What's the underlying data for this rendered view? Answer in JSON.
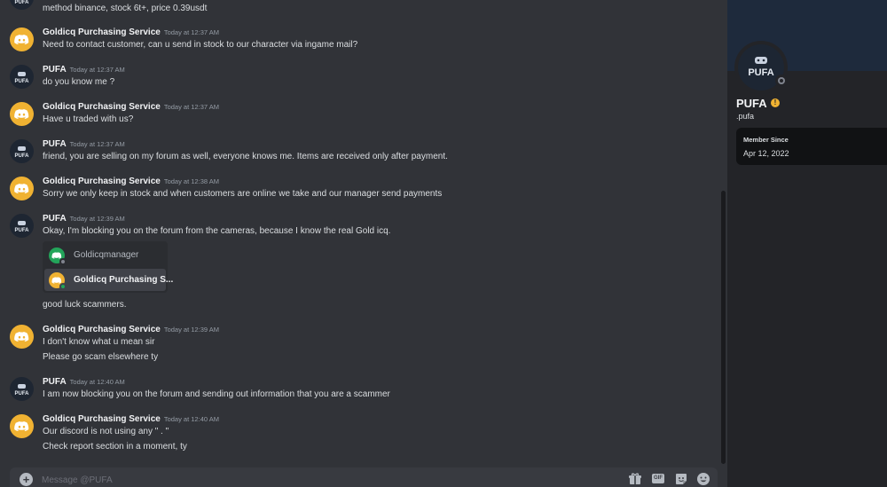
{
  "chat": {
    "messages": [
      {
        "id": "m0",
        "author": "",
        "time": "",
        "avatar": "pufa",
        "lines": [
          "method binance, stock 6t+, price 0.39usdt"
        ]
      },
      {
        "id": "m1",
        "author": "Goldicq Purchasing Service",
        "time": "Today at 12:37 AM",
        "avatar": "discord-yellow",
        "lines": [
          "Need to contact customer, can u send in stock to our character via ingame mail?"
        ]
      },
      {
        "id": "m2",
        "author": "PUFA",
        "time": "Today at 12:37 AM",
        "avatar": "pufa",
        "lines": [
          "do you know me  ?"
        ]
      },
      {
        "id": "m3",
        "author": "Goldicq Purchasing Service",
        "time": "Today at 12:37 AM",
        "avatar": "discord-yellow",
        "lines": [
          "Have u traded with us?"
        ]
      },
      {
        "id": "m4",
        "author": "PUFA",
        "time": "Today at 12:37 AM",
        "avatar": "pufa",
        "lines": [
          "friend, you are selling on my forum as well, everyone knows me. Items are received only after payment."
        ]
      },
      {
        "id": "m5",
        "author": "Goldicq Purchasing Service",
        "time": "Today at 12:38 AM",
        "avatar": "discord-yellow",
        "lines": [
          "Sorry we only keep in stock and when customers are online we take and our manager send payments"
        ]
      },
      {
        "id": "m6",
        "author": "PUFA",
        "time": "Today at 12:39 AM",
        "avatar": "pufa",
        "lines": [
          "Okay, I'm blocking you on the forum from the cameras, because I know the real Gold icq.",
          "good luck scammers."
        ]
      },
      {
        "id": "m7",
        "author": "Goldicq Purchasing Service",
        "time": "Today at 12:39 AM",
        "avatar": "discord-yellow",
        "lines": [
          "I don't know what u mean sir",
          "Please go scam elsewhere ty"
        ]
      },
      {
        "id": "m8",
        "author": "PUFA",
        "time": "Today at 12:40 AM",
        "avatar": "pufa",
        "lines": [
          "I am now blocking you on the forum and sending out information that you are a scammer"
        ]
      },
      {
        "id": "m9",
        "author": "Goldicq Purchasing Service",
        "time": "Today at 12:40 AM",
        "avatar": "discord-yellow",
        "lines": [
          "Our discord is not using any   \" . \"",
          "Check report section in a moment, ty"
        ]
      }
    ],
    "embedded_users": [
      {
        "name": "Goldicqmanager",
        "avatar_color": "#23a55a",
        "status": "offline"
      },
      {
        "name": "Goldicq Purchasing S...",
        "avatar_color": "#f0b232",
        "status": "online"
      }
    ]
  },
  "composer": {
    "placeholder": "Message @PUFA",
    "gif_label": "GIF",
    "icons": [
      "add-circle-icon",
      "gift-icon",
      "gif-icon",
      "sticker-icon",
      "emoji-icon"
    ]
  },
  "profile": {
    "display_name": "PUFA",
    "handle": ".pufa",
    "member_since_label": "Member Since",
    "member_since_date": "Apr 12, 2022",
    "avatar_text": "PUFA",
    "status": "offline"
  },
  "colors": {
    "chat_bg": "#313338",
    "sidebar_bg": "#232428",
    "discord_yellow": "#f0b232",
    "online_green": "#23a55a"
  }
}
